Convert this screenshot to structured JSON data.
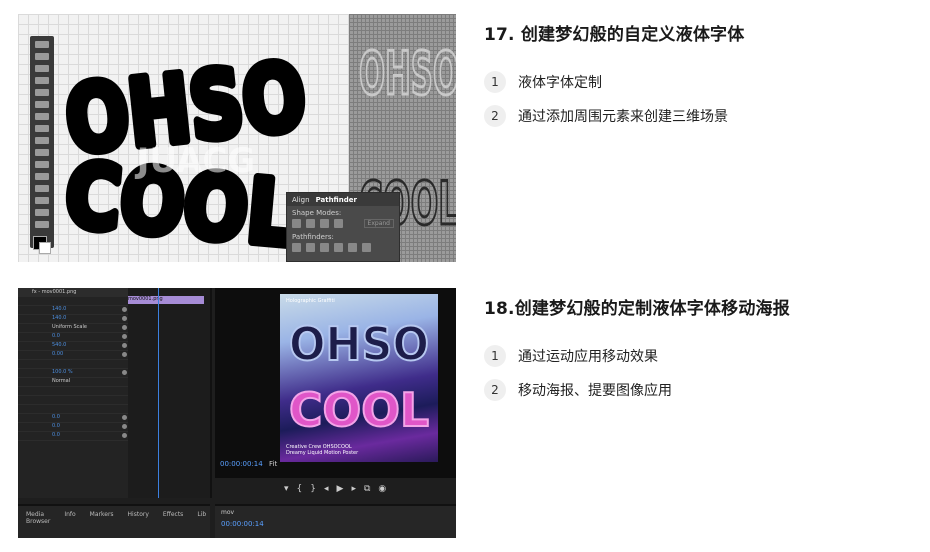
{
  "items": [
    {
      "title": "17. 创建梦幻般的自定义液体字体",
      "steps": [
        {
          "num": "1",
          "text": "液体字体定制"
        },
        {
          "num": "2",
          "text": "通过添加周围元素来创建三维场景"
        }
      ]
    },
    {
      "title": "18.创建梦幻般的定制液体字体移动海报",
      "steps": [
        {
          "num": "1",
          "text": "通过运动应用移动效果"
        },
        {
          "num": "2",
          "text": "移动海报、提要图像应用"
        }
      ]
    }
  ],
  "thumb1": {
    "art_line1": "OHSO",
    "art_line2": "COOL",
    "watermark": "JUACG",
    "pathfinder": {
      "tab_align": "Align",
      "tab_pathfinder": "Pathfinder",
      "shape_modes": "Shape Modes:",
      "pathfinders": "Pathfinders:",
      "expand": "Expand"
    }
  },
  "thumb2": {
    "source_tab": "fx - mov0001.png",
    "clip_name": "mov0001.png",
    "values": [
      "140.0",
      "140.0",
      "Uniform Scale",
      "0.0",
      "540.0",
      "0.00",
      "100.0 %",
      "Normal",
      "0.0",
      "0.0",
      "0.0"
    ],
    "timecode": "00:00:00:14",
    "fit": "Fit",
    "poster_header": "Holographic Graffiti",
    "poster_footer_1": "Creative Crew OHSOCOOL",
    "poster_footer_2": "Dreamy Liquid Motion Poster",
    "panel_tabs": [
      "Media Browser",
      "Info",
      "Markers",
      "History",
      "Effects",
      "Lib"
    ],
    "timeline_timecode": "00:00:00:14",
    "timeline_tab": "mov"
  },
  "colors": {
    "accent_blue": "#3c80e0",
    "clip_purple": "#a68cd6",
    "poster_pink": "#e056c8"
  }
}
